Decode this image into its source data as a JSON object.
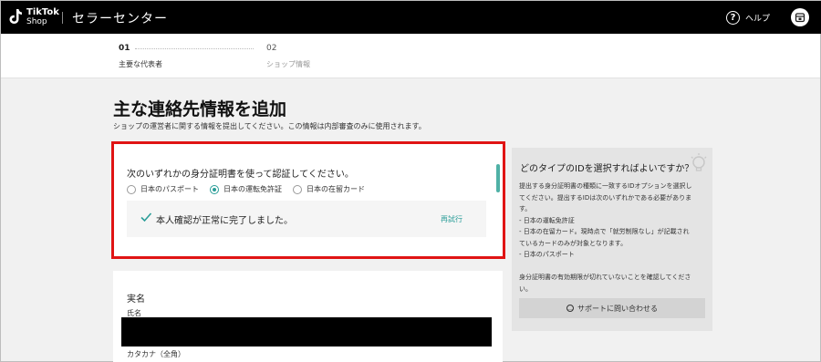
{
  "header": {
    "logo_line1": "TikTok",
    "logo_line2": "Shop",
    "app_title": "セラーセンター",
    "help_label": "ヘルプ",
    "help_icon": "question-circle-icon",
    "avatar_icon": "store-icon"
  },
  "steps": [
    {
      "num": "01",
      "label": "主要な代表者",
      "active": true
    },
    {
      "num": "02",
      "label": "ショップ情報",
      "active": false
    }
  ],
  "page": {
    "title": "主な連絡先情報を追加",
    "subtitle": "ショップの運営者に関する情報を提出してください。この情報は内部審査のみに使用されます。"
  },
  "id_section": {
    "question": "次のいずれかの身分証明書を使って認証してください。",
    "options": [
      {
        "label": "日本のパスポート",
        "selected": false
      },
      {
        "label": "日本の運転免許証",
        "selected": true
      },
      {
        "label": "日本の在留カード",
        "selected": false
      }
    ],
    "success_message": "本人確認が正常に完了しました。",
    "retry_label": "再試行"
  },
  "side_panel": {
    "title": "どのタイプのIDを選択すればよいですか？",
    "lines": [
      "提出する身分証明書の種類に一致するIDオプションを選択し",
      "てください。提出するIDは次のいずれかである必要がありま",
      "す。",
      "- 日本の運転免許証",
      "- 日本の在留カード。現時点で「就労制限なし」が記載され",
      "ているカードのみが対象となります。",
      "- 日本のパスポート",
      "",
      "身分証明書の有効期限が切れていないことを確認してくださ",
      "い。"
    ],
    "support_label": "サポートに問い合わせる"
  },
  "name_section": {
    "title": "実名",
    "field_label": "氏名",
    "kana_label": "カタカナ（全角）"
  },
  "colors": {
    "accent": "#2a9d98",
    "highlight_border": "#e01414",
    "topbar": "#000000"
  }
}
